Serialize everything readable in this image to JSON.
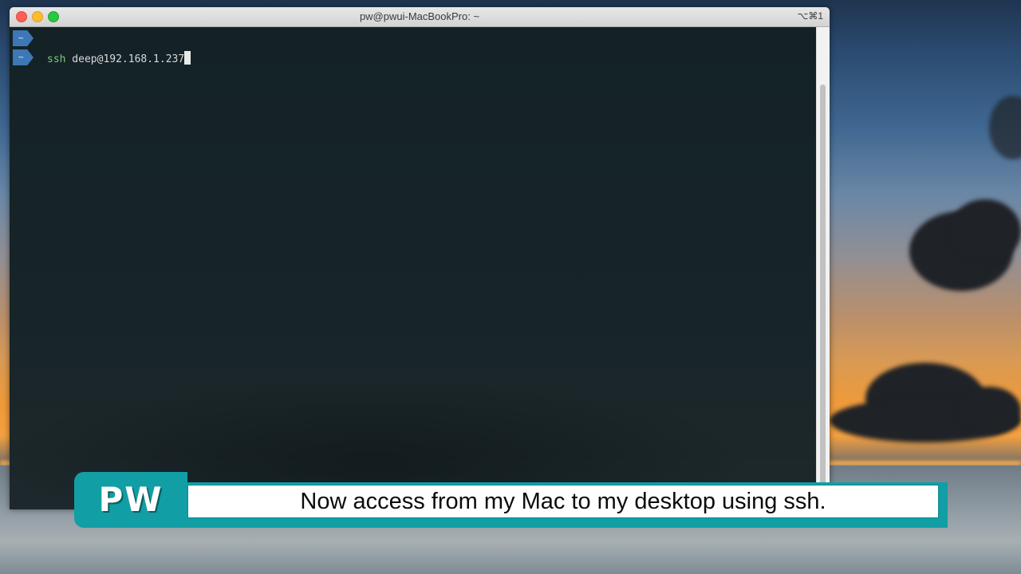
{
  "window": {
    "title": "pw@pwui-MacBookPro: ~",
    "shortcut": "⌥⌘1"
  },
  "terminal": {
    "prompt_symbol": "~",
    "command_keyword": "ssh",
    "command_args": " deep@192.168.1.237"
  },
  "caption": {
    "logo": "PW",
    "text": "Now access from my Mac to my desktop using ssh."
  },
  "colors": {
    "caption_accent": "#119ea5",
    "prompt_segment": "#3d77b6",
    "terminal_bg": "#142226"
  }
}
